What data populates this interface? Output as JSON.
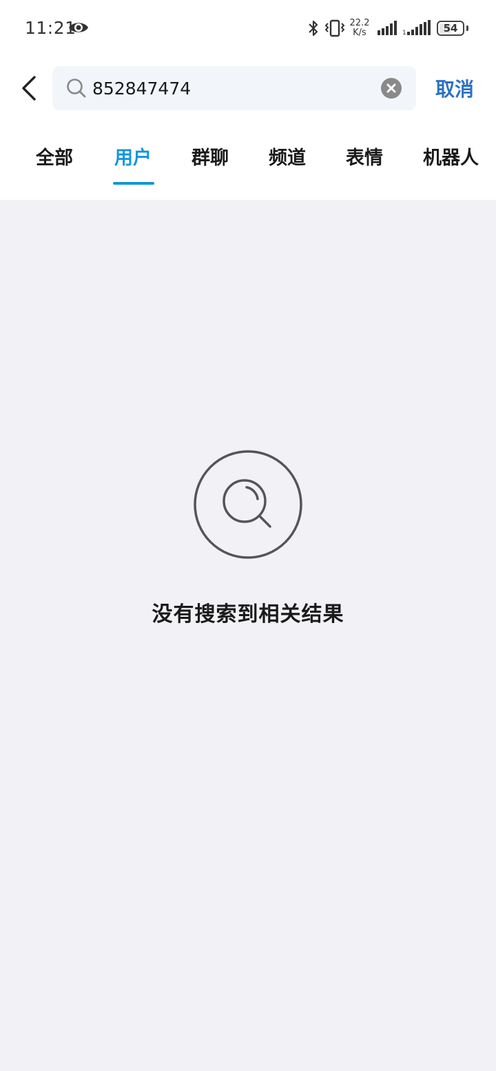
{
  "status_bar": {
    "time": "11:21",
    "net_speed_value": "22.2",
    "net_speed_unit": "K/s",
    "battery": "54",
    "icons": [
      "eye-icon",
      "bluetooth-icon",
      "vibrate-icon",
      "signal-icon",
      "signal-2-icon"
    ]
  },
  "search": {
    "value": "852847474",
    "cancel_label": "取消"
  },
  "tabs": [
    {
      "label": "全部",
      "active": false
    },
    {
      "label": "用户",
      "active": true
    },
    {
      "label": "群聊",
      "active": false
    },
    {
      "label": "频道",
      "active": false
    },
    {
      "label": "表情",
      "active": false
    },
    {
      "label": "机器人",
      "active": false
    }
  ],
  "empty_state": {
    "message": "没有搜索到相关结果",
    "icon": "search-icon"
  },
  "colors": {
    "accent": "#1296db",
    "cancel": "#2b72c4",
    "background": "#f1f1f6",
    "header": "#ffffff"
  }
}
